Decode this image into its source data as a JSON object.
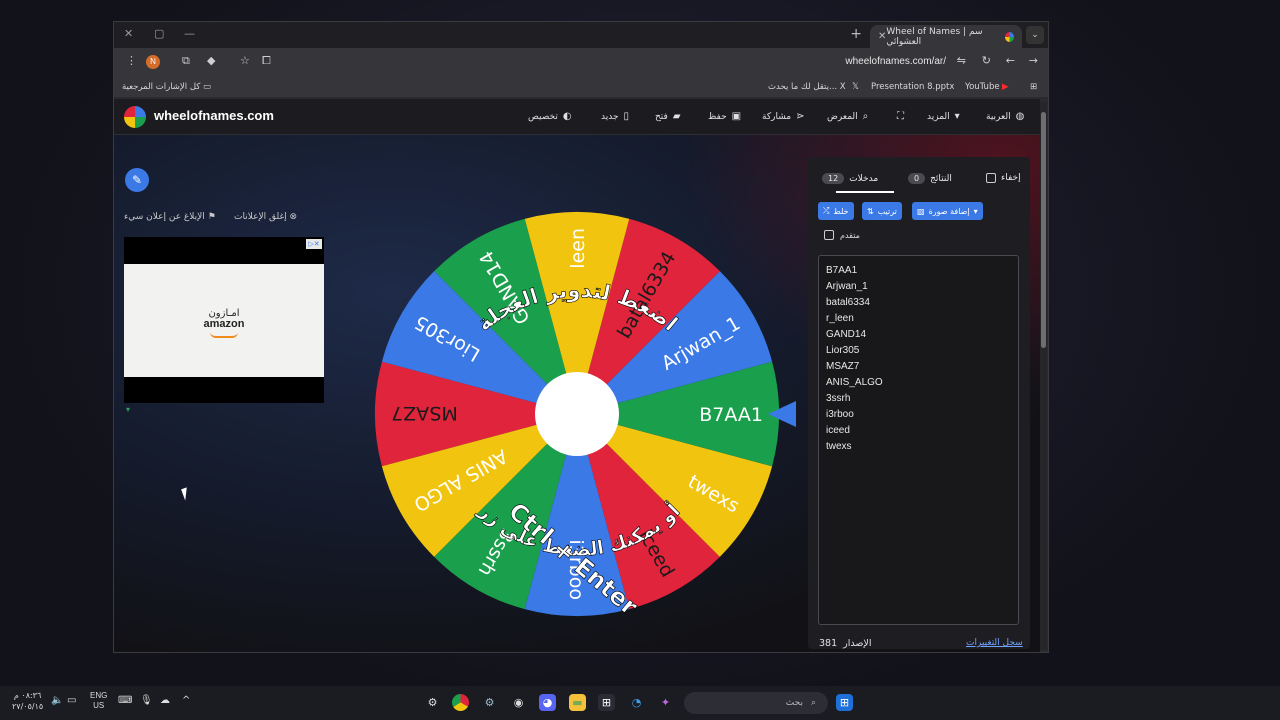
{
  "browser": {
    "tab_title": "Wheel of Names | سم العشوائي",
    "url": "wheelofnames.com/ar/",
    "profile_initial": "N",
    "bookmarks_right": "كل الإشارات المرجعية",
    "bookmarks": [
      "يتقل لك ما يحدث... X",
      "Presentation 8.pptx",
      "YouTube"
    ]
  },
  "site": {
    "logo": "wheelofnames.com",
    "nav": {
      "customize": "تخصيص",
      "new": "جديد",
      "open": "فتح",
      "save": "حفظ",
      "share": "مشاركة",
      "gallery": "المعرض",
      "more": "المزيد",
      "language": "العربية"
    },
    "ad_controls": {
      "hide_ads": "إغلق الإعلانات",
      "report_ad": "الإبلاغ عن إعلان سيء"
    },
    "ad": {
      "brand_ar": "امـازون",
      "brand": "amazon"
    }
  },
  "wheel": {
    "entries": [
      "B7AA1",
      "Arjwan_1",
      "batal6334",
      "r_leen",
      "GAND14",
      "Lior305",
      "MSAZ7",
      "ANIS_ALGO",
      "3ssrh",
      "i3rboo",
      "iceed",
      "twexs"
    ],
    "slice_labels": [
      "B7AA1",
      "Arjwan_1",
      "batal6334",
      "leen",
      "GAND14",
      "Lior305",
      "MSAZ7",
      "ANIS ALGO",
      "3ssrh",
      "i3rboo",
      "iceed",
      "twexs"
    ],
    "colors": [
      "#3b79e6",
      "#e0243b",
      "#f1c40f",
      "#1aa04c"
    ],
    "instruction_top": "اضغط لتدوير العجلة",
    "instruction_bottom": "أو يمكنك الضغط على زر",
    "shortcut": "Ctrl + Enter"
  },
  "panel": {
    "tab_entries": "مدخلات",
    "entries_count": "12",
    "tab_results": "النتائج",
    "results_count": "0",
    "hide_label": "إخفاء",
    "buttons": {
      "shuffle": "خلط",
      "sort": "ترتيب",
      "add_image": "إضافة صورة"
    },
    "advanced": "متقدم",
    "version_label": "الإصدار",
    "version": "381",
    "changelog": "سجل التغييرات"
  },
  "taskbar": {
    "search_placeholder": "بحث",
    "lang_top": "ENG",
    "lang_bottom": "US",
    "time": "٠٨:٣٦ م",
    "date": "٢٧/٠٥/١٥"
  }
}
